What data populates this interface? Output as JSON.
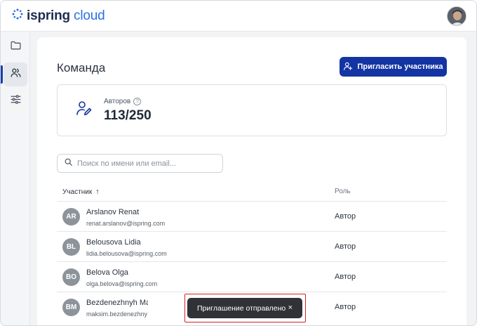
{
  "brand": {
    "part1": "ispring",
    "part2": "cloud"
  },
  "page": {
    "title": "Команда"
  },
  "invite_button": {
    "label": "Пригласить участника"
  },
  "stats": {
    "label": "Авторов",
    "help_glyph": "?",
    "value": "113/250"
  },
  "search": {
    "placeholder": "Поиск по имени или email..."
  },
  "table": {
    "col_name": "Участник",
    "sort_glyph": "↑",
    "col_role": "Роль",
    "rows": [
      {
        "initials": "AR",
        "name": "Arslanov Renat",
        "email": "renat.arslanov@ispring.com",
        "role": "Автор"
      },
      {
        "initials": "BL",
        "name": "Belousova Lidia",
        "email": "lidia.belousova@ispring.com",
        "role": "Автор"
      },
      {
        "initials": "BO",
        "name": "Belova Olga",
        "email": "olga.belova@ispring.com",
        "role": "Автор"
      },
      {
        "initials": "BM",
        "name": "Bezdenezhnyh Ma",
        "email": "maksim.bezdenezhny",
        "role": "Автор"
      }
    ]
  },
  "toast": {
    "message": "Приглашение отправлено",
    "close_glyph": "×"
  },
  "colors": {
    "accent": "#1434a4",
    "brand_blue": "#2a6ee8",
    "toast_bg": "#2f3236",
    "highlight": "#d92020"
  },
  "icons": {
    "logo": "ispring-logo-icon",
    "sidebar": [
      "folder-icon",
      "users-icon",
      "sliders-icon"
    ],
    "invite": "add-user-icon",
    "stat": "user-edit-icon",
    "search": "search-icon"
  }
}
